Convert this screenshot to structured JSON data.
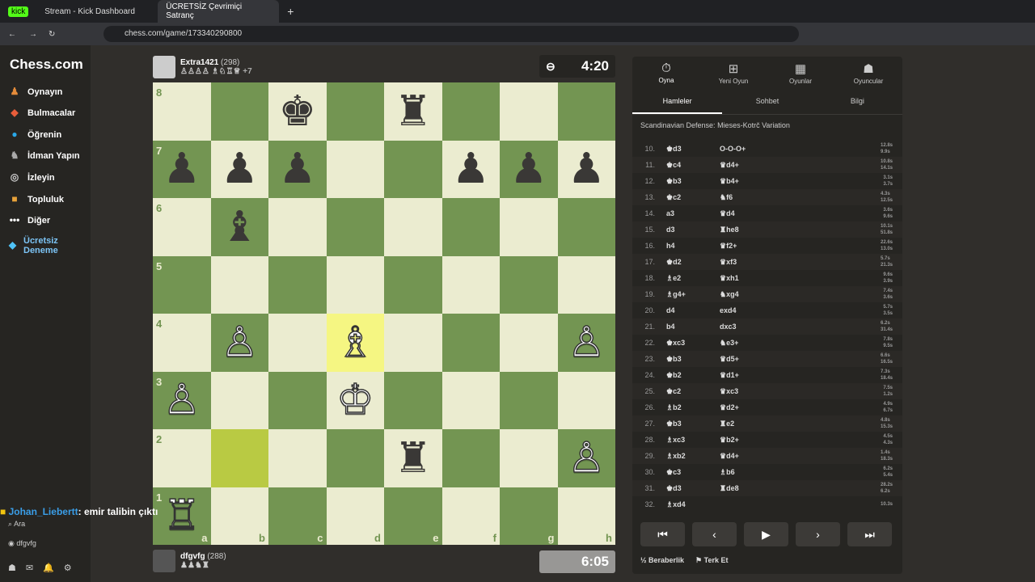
{
  "browser": {
    "tabs": [
      {
        "label": "kick"
      },
      {
        "label": "Stream - Kick Dashboard"
      },
      {
        "label": "ÜCRETSİZ Çevrimiçi Satranç"
      }
    ],
    "url": "chess.com/game/173340290800"
  },
  "nav": {
    "logo": "Chess.com",
    "items": [
      "Oynayın",
      "Bulmacalar",
      "Öğrenin",
      "İdman Yapın",
      "İzleyin",
      "Topluluk",
      "Diğer",
      "Ücretsiz Deneme"
    ],
    "search": "Ara",
    "user": "dfgvfg"
  },
  "top_player": {
    "name": "Extra1421",
    "rating": "(298)",
    "captured_extra": "+7",
    "clock": "4:20"
  },
  "bottom_player": {
    "name": "dfgvfg",
    "rating": "(288)",
    "clock": "6:05"
  },
  "board": {
    "ranks": [
      "8",
      "7",
      "6",
      "5",
      "4",
      "3",
      "2",
      "1"
    ],
    "files": [
      "a",
      "b",
      "c",
      "d",
      "e",
      "f",
      "g",
      "h"
    ],
    "pieces": [
      [
        "",
        "",
        "♚",
        "",
        "♜",
        "",
        "",
        ""
      ],
      [
        "♟",
        "♟",
        "♟",
        "",
        "",
        "♟",
        "♟",
        "♟"
      ],
      [
        "",
        "♝",
        "",
        "",
        "",
        "",
        "",
        ""
      ],
      [
        "",
        "",
        "",
        "",
        "",
        "",
        "",
        ""
      ],
      [
        "",
        "♙",
        "",
        "♗",
        "",
        "",
        "",
        "♙"
      ],
      [
        "♙",
        "",
        "",
        "♔",
        "",
        "",
        "",
        ""
      ],
      [
        "",
        "",
        "",
        "",
        "♜",
        "",
        "",
        "♙"
      ],
      [
        "♖",
        "",
        "",
        "",
        "",
        "",
        "",
        ""
      ]
    ]
  },
  "panel": {
    "tabs": [
      "Oyna",
      "Yeni Oyun",
      "Oyunlar",
      "Oyuncular"
    ],
    "subtabs": [
      "Hamleler",
      "Sohbet",
      "Bilgi"
    ],
    "opening": "Scandinavian Defense: Mieses-Kotrč Variation",
    "moves": [
      [
        "10.",
        "♚d3",
        "O-O-O+",
        "12.8s",
        "9.9s"
      ],
      [
        "11.",
        "♚c4",
        "♛d4+",
        "10.8s",
        "14.1s"
      ],
      [
        "12.",
        "♚b3",
        "♛b4+",
        "3.1s",
        "3.7s"
      ],
      [
        "13.",
        "♚c2",
        "♞f6",
        "4.3s",
        "12.5s"
      ],
      [
        "14.",
        "a3",
        "♛d4",
        "3.6s",
        "9.6s"
      ],
      [
        "15.",
        "d3",
        "♜he8",
        "10.1s",
        "51.8s"
      ],
      [
        "16.",
        "h4",
        "♛f2+",
        "22.6s",
        "13.0s"
      ],
      [
        "17.",
        "♚d2",
        "♛xf3",
        "5.7s",
        "21.3s"
      ],
      [
        "18.",
        "♗e2",
        "♛xh1",
        "9.6s",
        "3.9s"
      ],
      [
        "19.",
        "♗g4+",
        "♞xg4",
        "7.4s",
        "3.6s"
      ],
      [
        "20.",
        "d4",
        "exd4",
        "5.7s",
        "3.5s"
      ],
      [
        "21.",
        "b4",
        "dxc3",
        "6.2s",
        "31.4s"
      ],
      [
        "22.",
        "♚xc3",
        "♞e3+",
        "7.8s",
        "9.5s"
      ],
      [
        "23.",
        "♚b3",
        "♛d5+",
        "6.6s",
        "16.5s"
      ],
      [
        "24.",
        "♚b2",
        "♛d1+",
        "7.3s",
        "18.4s"
      ],
      [
        "25.",
        "♚c2",
        "♛xc3",
        "7.5s",
        "1.2s"
      ],
      [
        "26.",
        "♗b2",
        "♛d2+",
        "4.9s",
        "6.7s"
      ],
      [
        "27.",
        "♚b3",
        "♜e2",
        "4.8s",
        "15.3s"
      ],
      [
        "28.",
        "♗xc3",
        "♛b2+",
        "4.5s",
        "4.3s"
      ],
      [
        "29.",
        "♗xb2",
        "♛d4+",
        "1.4s",
        "18.3s"
      ],
      [
        "30.",
        "♚c3",
        "♗b6",
        "6.2s",
        "5.4s"
      ],
      [
        "31.",
        "♚d3",
        "♜de8",
        "28.2s",
        "6.2s"
      ],
      [
        "32.",
        "♗xd4",
        "",
        "10.3s",
        ""
      ]
    ]
  },
  "controls": {
    "draw": "Beraberlik",
    "resign": "Terk Et"
  },
  "chat": {
    "user": "Johan_Liebertt",
    "message": ": emir talibin çıktı"
  }
}
